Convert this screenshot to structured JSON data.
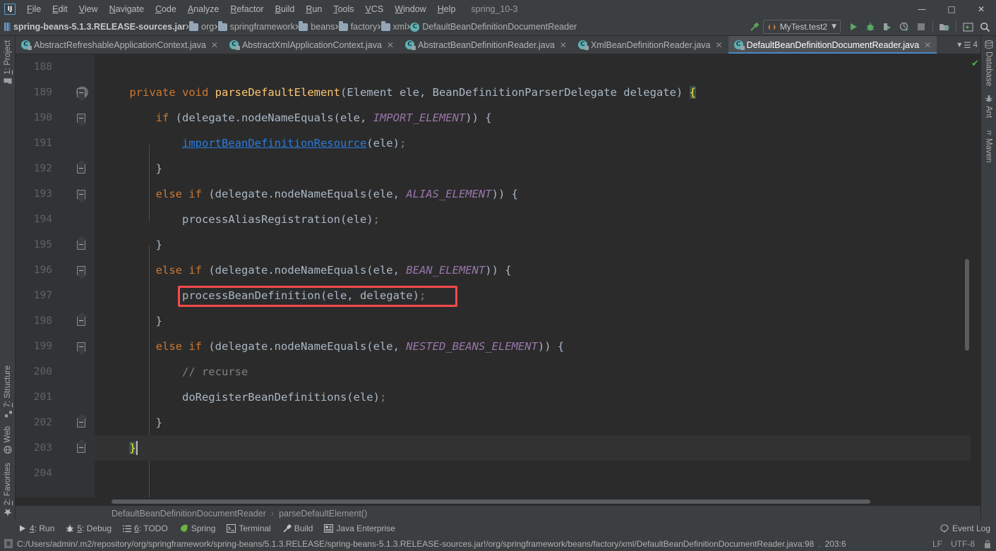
{
  "window": {
    "project_name": "spring_10-3",
    "logo": "intellij-logo",
    "minimize": "—",
    "maximize": "□",
    "close": "✕"
  },
  "menu": [
    {
      "label": "File",
      "mnemonic": "F"
    },
    {
      "label": "Edit",
      "mnemonic": "E"
    },
    {
      "label": "View",
      "mnemonic": "V"
    },
    {
      "label": "Navigate",
      "mnemonic": "N"
    },
    {
      "label": "Code",
      "mnemonic": "C"
    },
    {
      "label": "Analyze",
      "mnemonic": "A"
    },
    {
      "label": "Refactor",
      "mnemonic": "R"
    },
    {
      "label": "Build",
      "mnemonic": "B"
    },
    {
      "label": "Run",
      "mnemonic": "R"
    },
    {
      "label": "Tools",
      "mnemonic": "T"
    },
    {
      "label": "VCS",
      "mnemonic": "V"
    },
    {
      "label": "Window",
      "mnemonic": "W"
    },
    {
      "label": "Help",
      "mnemonic": "H"
    }
  ],
  "navbar": {
    "crumbs": [
      {
        "label": "spring-beans-5.1.3.RELEASE-sources.jar",
        "icon": "jar-icon"
      },
      {
        "label": "org",
        "icon": "folder-icon"
      },
      {
        "label": "springframework",
        "icon": "folder-icon"
      },
      {
        "label": "beans",
        "icon": "folder-icon"
      },
      {
        "label": "factory",
        "icon": "folder-icon"
      },
      {
        "label": "xml",
        "icon": "folder-icon"
      },
      {
        "label": "DefaultBeanDefinitionDocumentReader",
        "icon": "class-icon"
      }
    ],
    "run_config": "MyTest.test2",
    "buttons": [
      {
        "name": "run-button",
        "glyph": "▶"
      },
      {
        "name": "debug-button",
        "glyph": "bug"
      },
      {
        "name": "run-coverage-button",
        "glyph": "coverage"
      },
      {
        "name": "profile-button",
        "glyph": "profile"
      },
      {
        "name": "stop-button",
        "glyph": "■"
      },
      {
        "name": "project-structure-button",
        "glyph": "struct"
      },
      {
        "name": "updating-button",
        "glyph": "▷"
      },
      {
        "name": "search-everywhere-button",
        "glyph": "⌕"
      }
    ]
  },
  "editor_tabs": {
    "tabs": [
      {
        "label": "AbstractRefreshableApplicationContext.java",
        "active": false
      },
      {
        "label": "AbstractXmlApplicationContext.java",
        "active": false
      },
      {
        "label": "AbstractBeanDefinitionReader.java",
        "active": false
      },
      {
        "label": "XmlBeanDefinitionReader.java",
        "active": false
      },
      {
        "label": "DefaultBeanDefinitionDocumentReader.java",
        "active": true
      }
    ],
    "overflow_count": "4",
    "close_glyph": "✕"
  },
  "left_stripe": {
    "top": [
      {
        "label": "1: Project",
        "mnemonic": "1",
        "icon": "folder-icon"
      }
    ],
    "bottom": [
      {
        "label": "7: Structure",
        "mnemonic": "7",
        "icon": "structure-icon"
      },
      {
        "label": "Web",
        "mnemonic": "",
        "icon": "web-icon"
      },
      {
        "label": "2: Favorites",
        "mnemonic": "2",
        "icon": "star-icon"
      }
    ]
  },
  "right_stripe": {
    "top": [
      {
        "label": "Database",
        "icon": "database-icon"
      },
      {
        "label": "Ant",
        "icon": "ant-icon"
      },
      {
        "label": "Maven",
        "icon": "maven-icon"
      }
    ]
  },
  "editor": {
    "inspection_status": "ok",
    "first_line": 188,
    "lines": [
      {
        "num": 188,
        "tokens": [],
        "gutter": "",
        "annotation": ""
      },
      {
        "num": 189,
        "gutter": "fold-open",
        "annotation": "@",
        "tokens": [
          {
            "t": "    ",
            "c": "punct"
          },
          {
            "t": "private",
            "c": "kw"
          },
          {
            "t": " ",
            "c": "punct"
          },
          {
            "t": "void",
            "c": "kw"
          },
          {
            "t": " ",
            "c": "punct"
          },
          {
            "t": "parseDefaultElement",
            "c": "meth"
          },
          {
            "t": "(Element ele, BeanDefinitionParserDelegate delegate) ",
            "c": "ident"
          },
          {
            "t": "{",
            "c": "brace-hl"
          }
        ]
      },
      {
        "num": 190,
        "gutter": "fold-open",
        "annotation": "",
        "tokens": [
          {
            "t": "        ",
            "c": "punct"
          },
          {
            "t": "if",
            "c": "kw"
          },
          {
            "t": " (delegate.nodeNameEquals(ele, ",
            "c": "ident"
          },
          {
            "t": "IMPORT_ELEMENT",
            "c": "const"
          },
          {
            "t": ")) {",
            "c": "ident"
          }
        ]
      },
      {
        "num": 191,
        "gutter": "",
        "annotation": "",
        "tokens": [
          {
            "t": "            ",
            "c": "punct"
          },
          {
            "t": "importBeanDefinitionResource",
            "c": "link"
          },
          {
            "t": "(ele)",
            "c": "ident"
          },
          {
            "t": ";",
            "c": "cmt"
          }
        ]
      },
      {
        "num": 192,
        "gutter": "fold-close",
        "annotation": "",
        "tokens": [
          {
            "t": "        }",
            "c": "ident"
          }
        ]
      },
      {
        "num": 193,
        "gutter": "fold-open",
        "annotation": "",
        "tokens": [
          {
            "t": "        ",
            "c": "punct"
          },
          {
            "t": "else",
            "c": "kw"
          },
          {
            "t": " ",
            "c": "punct"
          },
          {
            "t": "if",
            "c": "kw"
          },
          {
            "t": " (delegate.nodeNameEquals(ele, ",
            "c": "ident"
          },
          {
            "t": "ALIAS_ELEMENT",
            "c": "const"
          },
          {
            "t": ")) {",
            "c": "ident"
          }
        ]
      },
      {
        "num": 194,
        "gutter": "",
        "annotation": "",
        "tokens": [
          {
            "t": "            processAliasRegistration(ele)",
            "c": "ident"
          },
          {
            "t": ";",
            "c": "cmt"
          }
        ]
      },
      {
        "num": 195,
        "gutter": "fold-close",
        "annotation": "",
        "tokens": [
          {
            "t": "        }",
            "c": "ident"
          }
        ]
      },
      {
        "num": 196,
        "gutter": "fold-open",
        "annotation": "",
        "tokens": [
          {
            "t": "        ",
            "c": "punct"
          },
          {
            "t": "else",
            "c": "kw"
          },
          {
            "t": " ",
            "c": "punct"
          },
          {
            "t": "if",
            "c": "kw"
          },
          {
            "t": " (delegate.nodeNameEquals(ele, ",
            "c": "ident"
          },
          {
            "t": "BEAN_ELEMENT",
            "c": "const"
          },
          {
            "t": ")) {",
            "c": "ident"
          }
        ]
      },
      {
        "num": 197,
        "gutter": "",
        "annotation": "",
        "highlight": true,
        "tokens": [
          {
            "t": "            processBeanDefinition(ele, delegate)",
            "c": "ident"
          },
          {
            "t": ";",
            "c": "cmt"
          }
        ]
      },
      {
        "num": 198,
        "gutter": "fold-close",
        "annotation": "",
        "tokens": [
          {
            "t": "        }",
            "c": "ident"
          }
        ]
      },
      {
        "num": 199,
        "gutter": "fold-open",
        "annotation": "",
        "tokens": [
          {
            "t": "        ",
            "c": "punct"
          },
          {
            "t": "else",
            "c": "kw"
          },
          {
            "t": " ",
            "c": "punct"
          },
          {
            "t": "if",
            "c": "kw"
          },
          {
            "t": " (delegate.nodeNameEquals(ele, ",
            "c": "ident"
          },
          {
            "t": "NESTED_BEANS_ELEMENT",
            "c": "const"
          },
          {
            "t": ")) {",
            "c": "ident"
          }
        ]
      },
      {
        "num": 200,
        "gutter": "",
        "annotation": "",
        "tokens": [
          {
            "t": "            // recurse",
            "c": "cmt"
          }
        ]
      },
      {
        "num": 201,
        "gutter": "",
        "annotation": "",
        "tokens": [
          {
            "t": "            doRegisterBeanDefinitions(ele)",
            "c": "ident"
          },
          {
            "t": ";",
            "c": "cmt"
          }
        ]
      },
      {
        "num": 202,
        "gutter": "fold-close",
        "annotation": "",
        "tokens": [
          {
            "t": "        }",
            "c": "ident"
          }
        ]
      },
      {
        "num": 203,
        "gutter": "fold-close",
        "annotation": "",
        "caret": true,
        "tokens": [
          {
            "t": "    ",
            "c": "punct"
          },
          {
            "t": "}",
            "c": "brace-hl"
          }
        ]
      },
      {
        "num": 204,
        "gutter": "",
        "annotation": "",
        "tokens": []
      }
    ]
  },
  "breadcrumb_strip": {
    "items": [
      "DefaultBeanDefinitionDocumentReader",
      "parseDefaultElement()"
    ],
    "separator": "›"
  },
  "bottom_bar": {
    "items": [
      {
        "label": "4: Run",
        "mnemonic": "4",
        "icon": "run-icon"
      },
      {
        "label": "5: Debug",
        "mnemonic": "5",
        "icon": "debug-icon"
      },
      {
        "label": "6: TODO",
        "mnemonic": "6",
        "icon": "todo-icon"
      },
      {
        "label": "Spring",
        "mnemonic": "",
        "icon": "spring-icon"
      },
      {
        "label": "Terminal",
        "mnemonic": "",
        "icon": "terminal-icon"
      },
      {
        "label": "Build",
        "mnemonic": "",
        "icon": "build-icon"
      },
      {
        "label": "Java Enterprise",
        "mnemonic": "",
        "icon": "java-enterprise-icon"
      }
    ],
    "event_log": "Event Log"
  },
  "status_bar": {
    "path": "C:/Users/admin/.m2/repository/org/springframework/spring-beans/5.1.3.RELEASE/spring-beans-5.1.3.RELEASE-sources.jar!/org/springframework/beans/factory/xml/DefaultBeanDefinitionDocumentReader.java:98",
    "separator": ".",
    "caret_position": "203:6",
    "line_separator": "LF",
    "encoding": "UTF-8",
    "lock_icon": "readonly-icon"
  },
  "colors": {
    "chrome": "#3c3f41",
    "editor_bg": "#2b2b2b",
    "gutter_bg": "#313335",
    "accent": "#4a88c7",
    "annotation_red": "#f54b4b",
    "keyword": "#cc7832",
    "method": "#ffc66d",
    "constant": "#9876aa",
    "link": "#287bde",
    "comment": "#808080",
    "ok_green": "#4caf50"
  }
}
